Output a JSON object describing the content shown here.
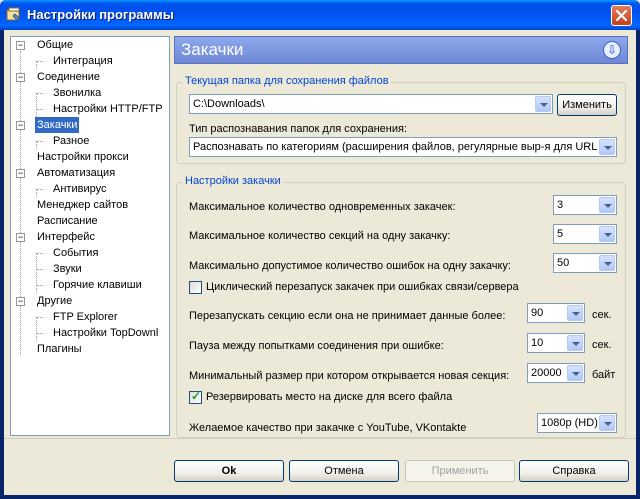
{
  "window": {
    "title": "Настройки программы"
  },
  "tree": {
    "items": [
      {
        "label": "Общие"
      },
      {
        "label": "Интеграция"
      },
      {
        "label": "Соединение"
      },
      {
        "label": "Звонилка"
      },
      {
        "label": "Настройки HTTP/FTP"
      },
      {
        "label": "Закачки"
      },
      {
        "label": "Разное"
      },
      {
        "label": "Настройки прокси"
      },
      {
        "label": "Автоматизация"
      },
      {
        "label": "Антивирус"
      },
      {
        "label": "Менеджер сайтов"
      },
      {
        "label": "Расписание"
      },
      {
        "label": "Интерфейс"
      },
      {
        "label": "События"
      },
      {
        "label": "Звуки"
      },
      {
        "label": "Горячие клавиши"
      },
      {
        "label": "Другие"
      },
      {
        "label": "FTP Explorer"
      },
      {
        "label": "Настройки TopDownl"
      },
      {
        "label": "Плагины"
      }
    ],
    "selected": "Закачки"
  },
  "header": {
    "title": "Закачки",
    "icon": "download-arrow-icon"
  },
  "folder_group": {
    "legend": "Текущая папка для сохранения файлов",
    "path_value": "C:\\Downloads\\",
    "change_button": "Изменить",
    "type_label": "Тип распознавания папок для сохранения:",
    "type_value": "Распознавать по категориям (расширения файлов, регулярные выр-я для URL"
  },
  "settings_group": {
    "legend": "Настройки закачки",
    "max_downloads_label": "Максимальное количество одновременных закачек:",
    "max_downloads_value": "3",
    "max_sections_label": "Максимальное количество секций на одну закачку:",
    "max_sections_value": "5",
    "max_errors_label": "Максимально допустимое количество ошибок на одну закачку:",
    "max_errors_value": "50",
    "cyclic_restart_label": "Циклический перезапуск закачек при ошибках связи/сервера",
    "cyclic_restart_checked": false,
    "restart_section_label": "Перезапускать секцию если она не принимает данные более:",
    "restart_section_value": "90",
    "restart_section_unit": "сек.",
    "pause_label": "Пауза между попытками соединения при ошибке:",
    "pause_value": "10",
    "pause_unit": "сек.",
    "min_size_label": "Минимальный размер при котором открывается новая секция:",
    "min_size_value": "20000",
    "min_size_unit": "байт",
    "reserve_label": "Резервировать место на диске для всего файла",
    "reserve_checked": true,
    "quality_label": "Желаемое качество при закачке с YouTube, VKontakte",
    "quality_value": "1080p (HD)"
  },
  "buttons": {
    "ok": "Ok",
    "cancel": "Отмена",
    "apply": "Применить",
    "help": "Справка"
  },
  "colors": {
    "selection": "#316AC5",
    "legend": "#0046D5",
    "header_bar": "#7A96DF"
  }
}
